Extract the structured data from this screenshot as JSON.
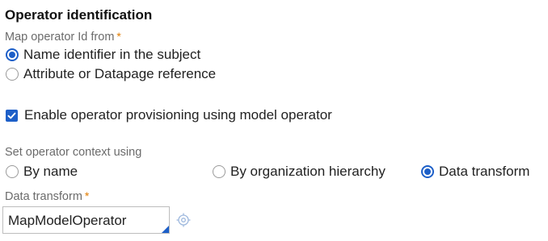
{
  "section": {
    "title": "Operator identification"
  },
  "map_operator": {
    "label": "Map operator Id from",
    "required_marker": "*",
    "options": [
      {
        "label": "Name identifier in the subject",
        "selected": true
      },
      {
        "label": "Attribute or Datapage reference",
        "selected": false
      }
    ]
  },
  "provisioning": {
    "label": "Enable operator provisioning using model operator",
    "checked": true
  },
  "operator_context": {
    "label": "Set operator context using",
    "options": [
      {
        "label": "By name",
        "selected": false
      },
      {
        "label": "By organization hierarchy",
        "selected": false
      },
      {
        "label": "Data transform",
        "selected": true
      }
    ]
  },
  "data_transform": {
    "label": "Data transform",
    "required_marker": "*",
    "value": "MapModelOperator",
    "lookup_icon": "target-icon"
  },
  "colors": {
    "accent": "#1d5fc8",
    "required": "#e07b00",
    "label": "#6b6b6b"
  }
}
